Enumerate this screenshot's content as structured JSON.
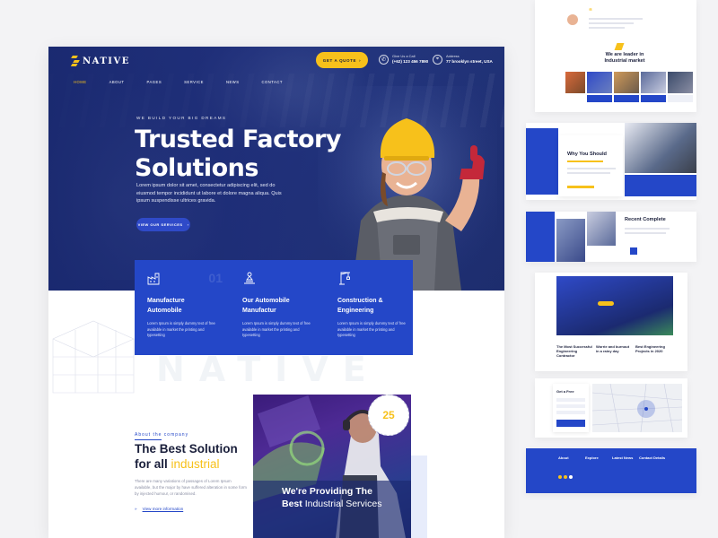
{
  "brand": {
    "name": "NATIVE"
  },
  "header": {
    "cta_label": "GET A QUOTE",
    "phone_label": "Give Us a Call",
    "phone": "(+62) 123 456 7890",
    "address_label": "Address",
    "address": "77 brooklyn street, USA"
  },
  "nav": {
    "items": [
      "HOME",
      "ABOUT",
      "PAGES",
      "SERVICE",
      "NEWS",
      "CONTACT"
    ],
    "active": "HOME"
  },
  "hero": {
    "kicker": "WE BUILD YOUR BIG DREAMS",
    "title_line1": "Trusted Factory",
    "title_line2": "Solutions",
    "description": "Lorem ipsum dolor sit amet, consectetur adipiscing elit, sed do eiusmod tempor incididunt ut labore et dolore magna aliqua. Quis ipsum suspendisse ultrices gravida.",
    "button": "VIEW OUR SERVICES"
  },
  "features": [
    {
      "title_line1": "Manufacture",
      "title_line2": "Automobile",
      "number": "01",
      "text": "Lorem Ipsum is simply dummy text of free available in market the printing and typesetting"
    },
    {
      "title_line1": "Our Automobile",
      "title_line2": "Manufactur",
      "number": "",
      "text": "Lorem Ipsum is simply dummy text of free available in market the printing and typesetting"
    },
    {
      "title_line1": "Construction &",
      "title_line2": "Engineering",
      "number": "",
      "text": "Lorem Ipsum is simply dummy text of free available in market the printing and typesetting"
    }
  ],
  "watermark": "NATIVE",
  "about": {
    "kicker": "About the company",
    "title_line1": "The Best Solution",
    "title_line2_plain": "for all",
    "title_line2_highlight": "industrial",
    "description": "There are many variations of passages of Lorem Ipsum available, but the major by have suffered alteration in some form by injected humour, or randomised.",
    "link": "View more information"
  },
  "promo": {
    "badge_number": "25",
    "caption_line1": "We're Providing The",
    "caption_bold": "Best",
    "caption_light": "Industrial Services"
  },
  "side": {
    "leader_title_line1": "We are leader in",
    "leader_title_line2": "Industrial market",
    "why_title_line1": "Why You Should",
    "recent_title_line1": "Recent Complete",
    "news": [
      {
        "title": "The Most Successful Engineering Contractor"
      },
      {
        "title": "Worrie and burnout in a rainy day"
      },
      {
        "title": "Best Engineering Projects in 2020"
      }
    ],
    "footer_cols": [
      "About",
      "Explore",
      "Latest News",
      "Contact Details"
    ],
    "form_title": "Get a Free"
  },
  "colors": {
    "primary": "#2447c8",
    "accent": "#f7c11b",
    "dark": "#1a1f3b"
  }
}
